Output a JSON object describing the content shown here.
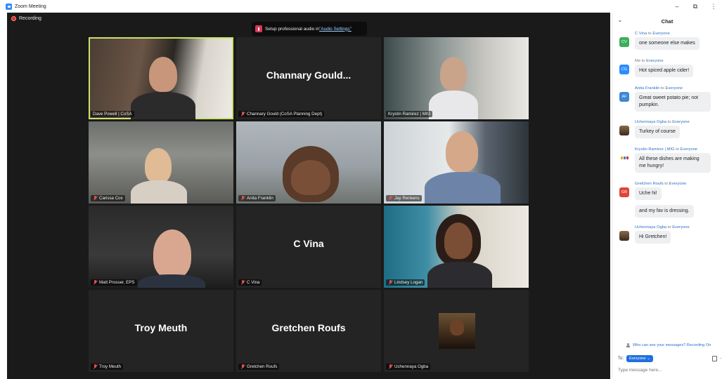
{
  "window": {
    "title": "Zoom Meeting",
    "minimize": "–",
    "restore": "⧉",
    "more": "⋮"
  },
  "meeting": {
    "recording_label": "Recording",
    "audio_banner_text": "Setup professional audio in ",
    "audio_banner_link": "\"Audio Settings\""
  },
  "tiles": [
    {
      "name": "Dave Powell | CoSA",
      "big_name": "",
      "muted": false,
      "active": true
    },
    {
      "name": "Channary Gould (CoSA Planning Dept)",
      "big_name": "Channary Gould...",
      "muted": true,
      "active": false
    },
    {
      "name": "Krystin Ramirez | MIG",
      "big_name": "",
      "muted": false,
      "active": false
    },
    {
      "name": "Carissa Cox",
      "big_name": "",
      "muted": true,
      "active": false
    },
    {
      "name": "Anita Franklin",
      "big_name": "",
      "muted": true,
      "active": false
    },
    {
      "name": "Jay Renkens",
      "big_name": "",
      "muted": true,
      "active": false
    },
    {
      "name": "Matt Prosser, EPS",
      "big_name": "",
      "muted": true,
      "active": false
    },
    {
      "name": "C Vina",
      "big_name": "C Vina",
      "muted": true,
      "active": false
    },
    {
      "name": "Lindsey Logan",
      "big_name": "",
      "muted": true,
      "active": false
    },
    {
      "name": "Troy Meuth",
      "big_name": "Troy Meuth",
      "muted": true,
      "active": false
    },
    {
      "name": "Gretchen Roufs",
      "big_name": "Gretchen Roufs",
      "muted": true,
      "active": false
    },
    {
      "name": "Uchennaya Ogba",
      "big_name": "",
      "muted": true,
      "active": false
    }
  ],
  "chat": {
    "title": "Chat",
    "collapse_icon": "⌄",
    "messages": [
      {
        "sender": "C Vina",
        "to_word": " to ",
        "recipient": "Everyone",
        "avatar": "CV",
        "avatar_color": "#3cae5a",
        "text": "one someone else makes"
      },
      {
        "sender": "Me",
        "to_word": " to ",
        "recipient": "Everyone",
        "avatar": "CG",
        "avatar_color": "#2d8cff",
        "text": "Hot spiced apple cider!"
      },
      {
        "sender": "Anita Franklin",
        "to_word": " to ",
        "recipient": "Everyone",
        "avatar": "AF",
        "avatar_color": "#3f86d6",
        "text": "Great sweet potato pie; not pumpkin."
      },
      {
        "sender": "Uchennaya Ogba",
        "to_word": " to ",
        "recipient": "Everyone",
        "avatar": "",
        "avatar_color": "",
        "text": "Turkey of course"
      },
      {
        "sender": "Krystin Ramirez | MIG",
        "to_word": " to ",
        "recipient": "Everyone",
        "avatar": "",
        "avatar_color": "",
        "text": "All these dishes are making me hungry!"
      },
      {
        "sender": "Gretchen Roufs",
        "to_word": " to ",
        "recipient": "Everyone",
        "avatar": "GR",
        "avatar_color": "#e0453a",
        "text": "Uche hi!"
      },
      {
        "sender": "",
        "to_word": "",
        "recipient": "",
        "avatar": "",
        "avatar_color": "",
        "text": "and my fav is dressing."
      },
      {
        "sender": "Uchennaya Ogba",
        "to_word": " to ",
        "recipient": "Everyone",
        "avatar": "",
        "avatar_color": "",
        "text": "Hi Gretchen!"
      }
    ],
    "privacy_text": "Who can see your messages? Recording On",
    "to_label": "To:",
    "to_value": "Everyone ⌄",
    "input_placeholder": "Type message here..."
  }
}
